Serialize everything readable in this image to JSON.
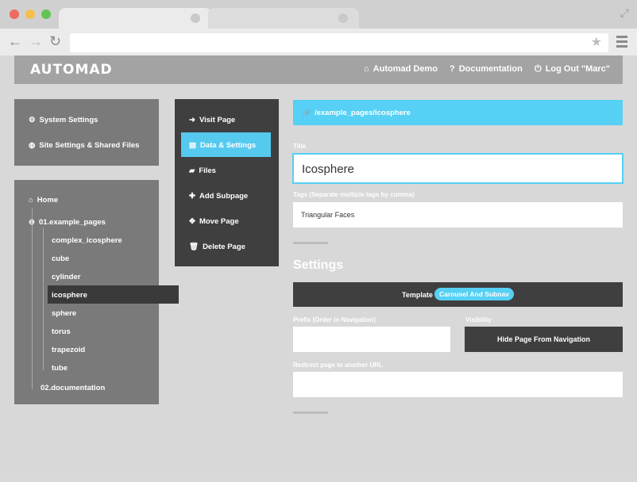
{
  "browser": {
    "controls": {
      "close_color": "#ec6a5e",
      "minimize_color": "#f4bf4f",
      "maximize_color": "#61c554"
    },
    "toolbar": {
      "back_icon": "←",
      "forward_icon": "→",
      "reload_icon": "↻",
      "star_icon": "★"
    },
    "resize_icon": "⤢"
  },
  "header": {
    "logo": "AUTOMAD",
    "nav": [
      {
        "icon": "home-icon",
        "glyph": "⌂",
        "label": "Automad Demo"
      },
      {
        "icon": "help-icon",
        "glyph": "?",
        "label": "Documentation"
      },
      {
        "icon": "power-icon",
        "glyph": "⏻",
        "label": "Log Out \"Marc\""
      }
    ]
  },
  "settings_panel": {
    "items": [
      {
        "icon": "gear-icon",
        "glyph": "⚙",
        "label": "System Settings"
      },
      {
        "icon": "globe-icon",
        "glyph": "◍",
        "label": "Site Settings & Shared Files"
      }
    ]
  },
  "tree": {
    "home": {
      "glyph": "⌂",
      "label": "Home"
    },
    "root": {
      "glyph": "⊖",
      "label": "01.example_pages"
    },
    "children": [
      "complex_icosphere",
      "cube",
      "cylinder",
      "icosphere",
      "sphere",
      "torus",
      "trapezoid",
      "tube"
    ],
    "last": "02.documentation"
  },
  "context_menu": {
    "items": [
      {
        "icon": "arrow-right-icon",
        "glyph": "➜",
        "label": "Visit Page"
      },
      {
        "icon": "file-icon",
        "glyph": "▤",
        "label": "Data & Settings"
      },
      {
        "icon": "folder-icon",
        "glyph": "▰",
        "label": "Files"
      },
      {
        "icon": "plus-icon",
        "glyph": "✚",
        "label": "Add Subpage"
      },
      {
        "icon": "move-icon",
        "glyph": "✥",
        "label": "Move Page"
      },
      {
        "icon": "trash-icon",
        "glyph": "🗑",
        "label": "Delete Page"
      }
    ]
  },
  "editor": {
    "path": "/example_pages/icosphere",
    "path_glyph": "🔗",
    "title_label": "Title",
    "title_value": "Icosphere",
    "tags_label": "Tags (Separate multiple tags by comma)",
    "tags_value": "Triangular Faces",
    "settings_heading": "Settings",
    "template_label": "Template",
    "template_value": "Carousel And Subnav",
    "prefix_label": "Prefix (Order in Navigation)",
    "visibility_label": "Visibility",
    "hide_button": "Hide Page From Navigation",
    "redirect_label": "Redirect page to another URL"
  },
  "colors": {
    "accent": "#56d0f5",
    "dark": "#3f3f3f",
    "panel": "#7a7a7a"
  }
}
